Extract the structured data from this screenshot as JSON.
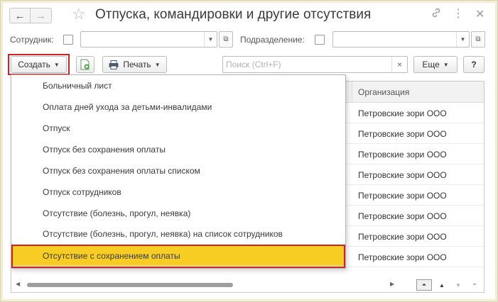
{
  "window": {
    "title": "Отпуска, командировки и другие отсутствия"
  },
  "header": {
    "back_icon": "←",
    "forward_icon": "→",
    "star_icon": "☆",
    "link_icon": "🔗",
    "more_icon": "⋮",
    "close_icon": "✕"
  },
  "filters": {
    "employee_label": "Сотрудник:",
    "employee_value": "",
    "department_label": "Подразделение:",
    "department_value": ""
  },
  "toolbar": {
    "create_label": "Создать",
    "print_label": "Печать",
    "search_placeholder": "Поиск (Ctrl+F)",
    "search_clear": "×",
    "more_label": "Еще",
    "help_label": "?"
  },
  "table": {
    "columns": {
      "organization": "Организация"
    },
    "rows": [
      {
        "organization": "Петровские зори ООО"
      },
      {
        "organization": "Петровские зори ООО"
      },
      {
        "organization": "Петровские зори ООО"
      },
      {
        "organization": "Петровские зори ООО"
      },
      {
        "organization": "Петровские зори ООО"
      },
      {
        "organization": "Петровские зори ООО"
      },
      {
        "organization": "Петровские зори ООО"
      },
      {
        "organization": "Петровские зори ООО"
      }
    ]
  },
  "create_menu": {
    "items": [
      {
        "label": "Больничный лист"
      },
      {
        "label": "Оплата дней ухода за детьми-инвалидами"
      },
      {
        "label": "Отпуск"
      },
      {
        "label": "Отпуск без сохранения оплаты"
      },
      {
        "label": "Отпуск без сохранения оплаты списком"
      },
      {
        "label": "Отпуск сотрудников"
      },
      {
        "label": "Отсутствие (болезнь, прогул, неявка)"
      },
      {
        "label": "Отсутствие (болезнь, прогул, неявка) на список сотрудников"
      },
      {
        "label": "Отсутствие с сохранением оплаты"
      }
    ],
    "active_index": 8
  },
  "colors": {
    "highlight": "#f7cd24",
    "annotation_frame": "#d42020"
  }
}
